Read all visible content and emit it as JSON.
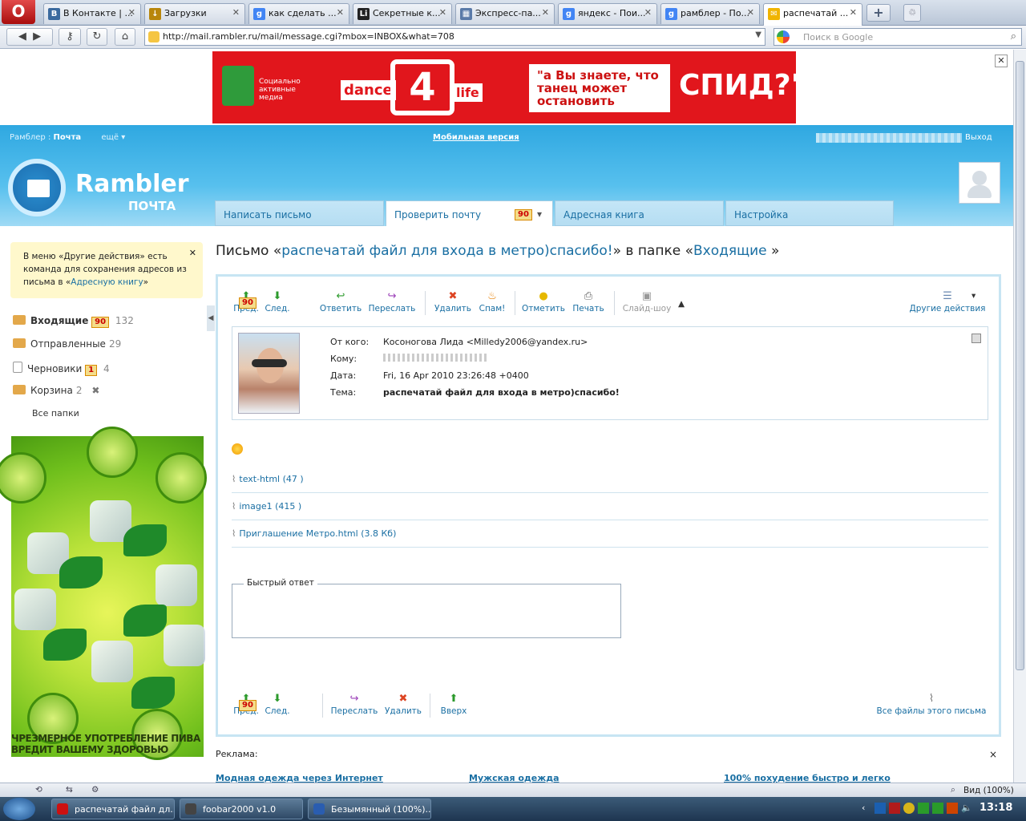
{
  "browser": {
    "tabs": [
      {
        "label": "В Контакте | ...",
        "icon": "vk-icon",
        "color": "#3b6a9e"
      },
      {
        "label": "Загрузки",
        "icon": "download-icon",
        "color": "#b8860b"
      },
      {
        "label": "как сделать ...",
        "icon": "google-icon",
        "color": "#4285f4"
      },
      {
        "label": "Секретные к...",
        "icon": "liveinternet-icon",
        "color": "#222222"
      },
      {
        "label": "Экспресс-па...",
        "icon": "speed-dial-icon",
        "color": "#5a7aa8"
      },
      {
        "label": "яндекс - Пои...",
        "icon": "google-icon",
        "color": "#4285f4"
      },
      {
        "label": "рамблер - По...",
        "icon": "google-icon",
        "color": "#4285f4"
      },
      {
        "label": "распечатай ...",
        "icon": "rambler-icon",
        "color": "#f0b400"
      }
    ],
    "url": "http://mail.rambler.ru/mail/message.cgi?mbox=INBOX&what=708",
    "search_placeholder": "Поиск в Google"
  },
  "banner": {
    "sponsor": "Социально активные медиа",
    "dance": "dance",
    "four": "4",
    "life": "life",
    "question": "\"а Вы знаете, что танец может остановить",
    "spid": "СПИД?\""
  },
  "header": {
    "rambler": "Рамблер",
    "separator": ":",
    "service": "Почта",
    "more": "ещё",
    "mobile": "Мобильная версия",
    "exit": "Выход",
    "brand": "Rambler",
    "subbrand": "ПОЧТА",
    "tabs": {
      "compose": "Написать письмо",
      "check": "Проверить почту",
      "check_count": "90",
      "addressbook": "Адресная книга",
      "settings": "Настройка"
    }
  },
  "sidebar": {
    "tip_text": "В меню «Другие действия» есть команда для сохранения адресов из письма в «",
    "tip_link": "Адресную книгу",
    "tip_end": "»",
    "folders": [
      {
        "name": "Входящие",
        "badge": "90",
        "count": "132"
      },
      {
        "name": "Отправленные",
        "count": "29"
      },
      {
        "name": "Черновики",
        "badge": "1",
        "count": "4"
      },
      {
        "name": "Корзина",
        "count": "2"
      }
    ],
    "all_folders": "Все папки",
    "ad_caption": "ЧРЕЗМЕРНОЕ УПОТРЕБЛЕНИЕ ПИВА ВРЕДИТ ВАШЕМУ ЗДОРОВЬЮ"
  },
  "message": {
    "title_prefix": "Письмо «",
    "subject_link": "распечатай файл для входа в метро)спасибо!",
    "title_mid": "» в папке «",
    "folder_link": "Входящие ",
    "title_suffix": "»",
    "toolbar": {
      "prev": "Пред.",
      "prev_badge": "90",
      "next": "След.",
      "reply": "Ответить",
      "forward": "Переслать",
      "delete": "Удалить",
      "spam": "Спам!",
      "mark": "Отметить",
      "print": "Печать",
      "slideshow": "Слайд-шоу",
      "other": "Другие действия"
    },
    "labels": {
      "from": "От кого:",
      "to": "Кому:",
      "date": "Дата:",
      "subject": "Тема:"
    },
    "from": "Косоногова Лида <Milledy2006@yandex.ru>",
    "to": "",
    "date": "Fri, 16 Apr 2010 23:26:48 +0400",
    "subject": "распечатай файл для входа в метро)спасибо!",
    "attachments": [
      "text-html (47 )",
      "image1 (415 )",
      "Приглашение Метро.html (3.8 Кб)"
    ],
    "quick_reply": "Быстрый ответ",
    "bottom_toolbar": {
      "prev": "Пред.",
      "prev_badge": "90",
      "next": "След.",
      "forward": "Переслать",
      "delete": "Удалить",
      "up": "Вверх",
      "all_files": "Все файлы этого письма"
    }
  },
  "ads": {
    "label": "Реклама:",
    "close": "×",
    "links": [
      "Модная одежда через Интернет",
      "Мужская одежда",
      "100% похудение быстро и легко"
    ]
  },
  "statusbar": {
    "zoom": "Вид (100%)"
  },
  "taskbar": {
    "items": [
      {
        "label": "распечатай файл дл...",
        "color": "#cc1111"
      },
      {
        "label": "foobar2000 v1.0",
        "color": "#444444"
      },
      {
        "label": "Безымянный (100%)...",
        "color": "#2a5db0"
      }
    ],
    "time": "13:18"
  }
}
